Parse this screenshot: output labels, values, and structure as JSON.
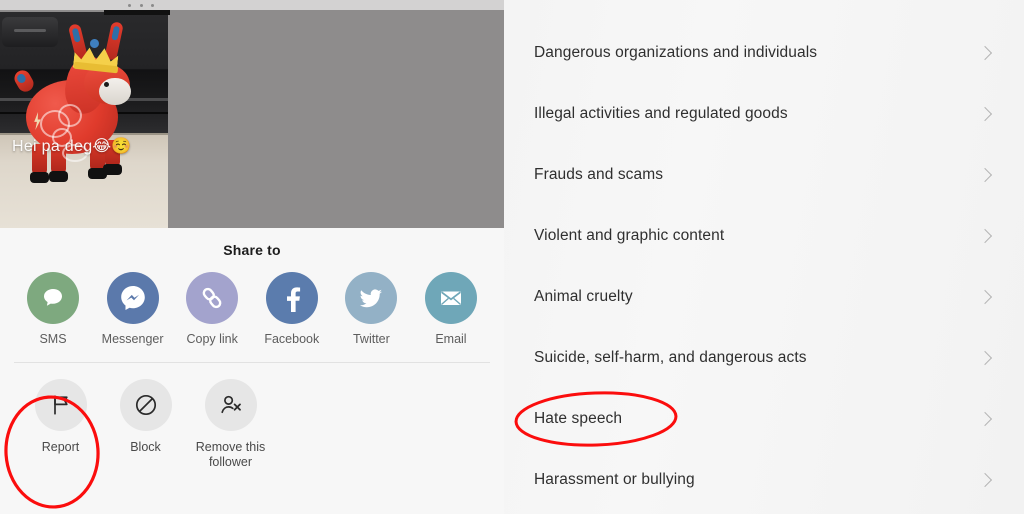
{
  "app": {
    "platform_hint": "tiktok-share-and-report-flow"
  },
  "left_panel": {
    "top_bar": {
      "more_icon": "more-horizontal-icon"
    },
    "video": {
      "caption": "Hei pa deg",
      "caption_emojis": "😂☺️",
      "scene_description_hidden": ""
    },
    "share_sheet": {
      "title": "Share to",
      "share_targets": [
        {
          "label": "SMS",
          "icon": "sms-chat-bubble-icon",
          "color": "#7ea97f"
        },
        {
          "label": "Messenger",
          "icon": "messenger-icon",
          "color": "#5b79ab"
        },
        {
          "label": "Copy link",
          "icon": "link-chain-icon",
          "color": "#a3a3cd"
        },
        {
          "label": "Facebook",
          "icon": "facebook-icon",
          "color": "#5b7cad"
        },
        {
          "label": "Twitter",
          "icon": "twitter-bird-icon",
          "color": "#93b1c6"
        },
        {
          "label": "Email",
          "icon": "envelope-icon",
          "color": "#6fa7b8"
        }
      ],
      "actions": [
        {
          "label": "Report",
          "icon": "flag-icon",
          "highlighted": true
        },
        {
          "label": "Block",
          "icon": "block-no-entry-icon",
          "highlighted": false
        },
        {
          "label": "Remove this follower",
          "icon": "person-remove-icon",
          "highlighted": false
        }
      ]
    }
  },
  "right_panel": {
    "reasons": [
      {
        "label": "Dangerous organizations and individuals",
        "chevron": "chevron-right-icon",
        "highlighted": false
      },
      {
        "label": "Illegal activities and regulated goods",
        "chevron": "chevron-right-icon",
        "highlighted": false
      },
      {
        "label": "Frauds and scams",
        "chevron": "chevron-right-icon",
        "highlighted": false
      },
      {
        "label": "Violent and graphic content",
        "chevron": "chevron-right-icon",
        "highlighted": false
      },
      {
        "label": "Animal cruelty",
        "chevron": "chevron-right-icon",
        "highlighted": false
      },
      {
        "label": "Suicide, self-harm, and dangerous acts",
        "chevron": "chevron-right-icon",
        "highlighted": false
      },
      {
        "label": "Hate speech",
        "chevron": "chevron-right-icon",
        "highlighted": true
      },
      {
        "label": "Harassment or bullying",
        "chevron": "chevron-right-icon",
        "highlighted": false
      }
    ]
  },
  "annotations": {
    "color": "#fb0d0d",
    "shapes": [
      {
        "target": "Report",
        "type": "ellipse"
      },
      {
        "target": "Hate speech",
        "type": "ellipse"
      }
    ]
  }
}
